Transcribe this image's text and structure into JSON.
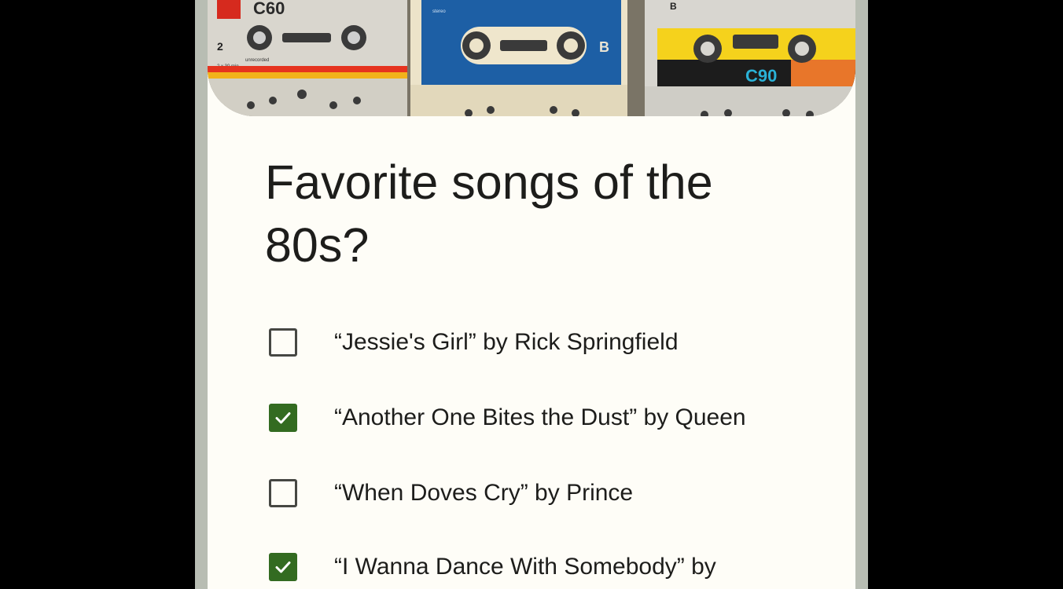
{
  "header_image": {
    "tapes": [
      {
        "brand": "C60",
        "side": "2",
        "note": "unrecorded",
        "length": "2 x 30 min"
      },
      {
        "side_label": "B",
        "stereo": "stereo"
      },
      {
        "side": "B",
        "label": "C90"
      }
    ]
  },
  "form": {
    "title": "Favorite songs of the 80s?",
    "options": [
      {
        "label": "“Jessie's Girl” by Rick Springfield",
        "checked": false
      },
      {
        "label": "“Another One Bites the Dust” by Queen",
        "checked": true
      },
      {
        "label": "“When Doves Cry” by Prince",
        "checked": false
      },
      {
        "label": "“I Wanna Dance With Somebody” by",
        "checked": true
      }
    ]
  },
  "colors": {
    "background": "#000000",
    "frame": "#b8bdb3",
    "card": "#fefdf7",
    "text": "#1d1d1b",
    "checkbox_checked": "#336b21",
    "checkbox_border": "#464743"
  }
}
